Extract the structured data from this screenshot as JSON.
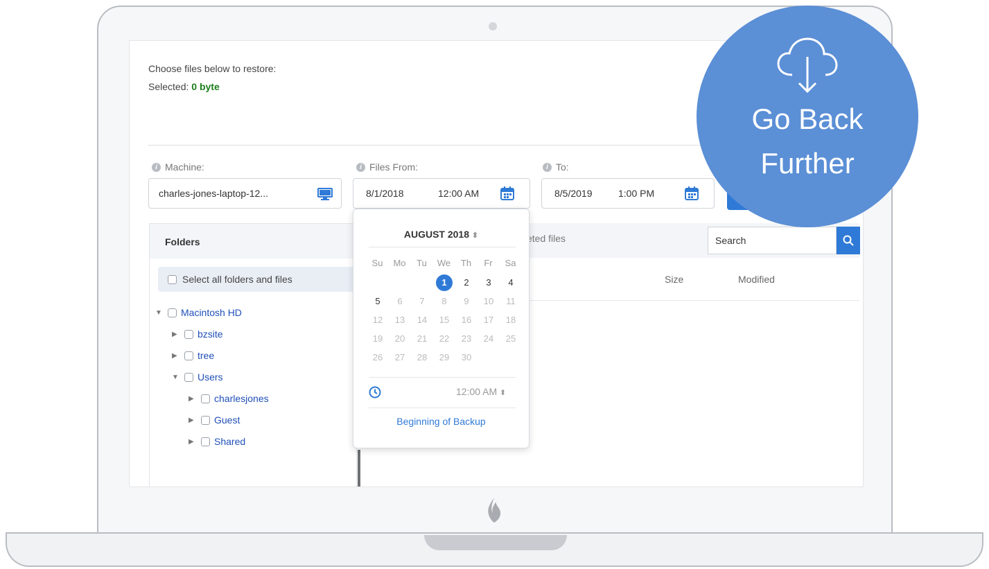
{
  "restore": {
    "choose_label": "Choose files below to restore:",
    "selected_label": "Selected:",
    "selected_value": "0 byte"
  },
  "filters": {
    "machine_label": "Machine:",
    "machine_value": "charles-jones-laptop-12...",
    "from_label": "Files From:",
    "from_date": "8/1/2018",
    "from_time": "12:00 AM",
    "to_label": "To:",
    "to_date": "8/5/2019",
    "to_time": "1:00 PM"
  },
  "folders": {
    "title": "Folders",
    "select_all": "Select all folders and files",
    "tree": [
      {
        "label": "Macintosh HD",
        "expanded": true
      },
      {
        "label": "bzsite",
        "expanded": false
      },
      {
        "label": "tree",
        "expanded": false
      },
      {
        "label": "Users",
        "expanded": true
      },
      {
        "label": "charlesjones",
        "expanded": false
      },
      {
        "label": "Guest",
        "expanded": false
      },
      {
        "label": "Shared",
        "expanded": false
      }
    ]
  },
  "files": {
    "deleted_text": "eted files",
    "search_placeholder": "Search",
    "columns": [
      "Size",
      "Modified"
    ]
  },
  "calendar": {
    "title": "AUGUST 2018",
    "weekdays": [
      "Su",
      "Mo",
      "Tu",
      "We",
      "Th",
      "Fr",
      "Sa"
    ],
    "days": [
      1,
      2,
      3,
      4,
      5,
      6,
      7,
      8,
      9,
      10,
      11,
      12,
      13,
      14,
      15,
      16,
      17,
      18,
      19,
      20,
      21,
      22,
      23,
      24,
      25,
      26,
      27,
      28,
      29,
      30
    ],
    "selected_day": 1,
    "time": "12:00 AM",
    "beginning_link": "Beginning of Backup"
  },
  "promo": {
    "line1": "Go Back",
    "line2": "Further"
  },
  "colors": {
    "accent": "#2f7ad6",
    "promo": "#5b8fd6",
    "selected_green": "#1a7d1a"
  }
}
